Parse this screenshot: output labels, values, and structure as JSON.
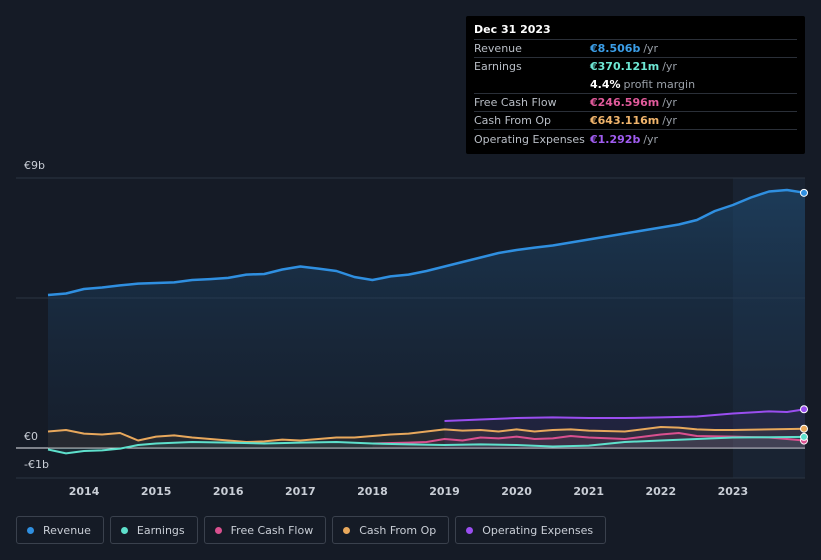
{
  "tooltip": {
    "date": "Dec 31 2023",
    "rows": [
      {
        "label": "Revenue",
        "value": "€8.506b",
        "unit": "/yr",
        "color": "#3b9ee8"
      },
      {
        "label": "Earnings",
        "value": "€370.121m",
        "unit": "/yr",
        "color": "#6ee7d4"
      },
      {
        "label": "",
        "value": "4.4%",
        "unit": "profit margin",
        "color": "#ffffff"
      },
      {
        "label": "Free Cash Flow",
        "value": "€246.596m",
        "unit": "/yr",
        "color": "#e05a9b"
      },
      {
        "label": "Cash From Op",
        "value": "€643.116m",
        "unit": "/yr",
        "color": "#f0b46c"
      },
      {
        "label": "Operating Expenses",
        "value": "€1.292b",
        "unit": "/yr",
        "color": "#a05cf0"
      }
    ]
  },
  "legend": [
    {
      "name": "Revenue",
      "color": "#2f8fe0"
    },
    {
      "name": "Earnings",
      "color": "#5ee0cc"
    },
    {
      "name": "Free Cash Flow",
      "color": "#d9508f"
    },
    {
      "name": "Cash From Op",
      "color": "#e8a85c"
    },
    {
      "name": "Operating Expenses",
      "color": "#9a4ef0"
    }
  ],
  "chart_data": {
    "type": "line",
    "yaxis_labels": [
      {
        "value": 9,
        "label": "€9b"
      },
      {
        "value": 0,
        "label": "€0"
      },
      {
        "value": -1,
        "label": "-€1b"
      }
    ],
    "ylim": [
      -1,
      9
    ],
    "xlim": [
      2013.5,
      2024.0
    ],
    "x_ticks": [
      2014,
      2015,
      2016,
      2017,
      2018,
      2019,
      2020,
      2021,
      2022,
      2023
    ],
    "highlight_from": 2023.0,
    "series": [
      {
        "name": "Revenue",
        "color": "#2f8fe0",
        "area": true,
        "points": [
          [
            2013.5,
            5.1
          ],
          [
            2013.75,
            5.15
          ],
          [
            2014.0,
            5.3
          ],
          [
            2014.25,
            5.35
          ],
          [
            2014.5,
            5.42
          ],
          [
            2014.75,
            5.48
          ],
          [
            2015.0,
            5.5
          ],
          [
            2015.25,
            5.52
          ],
          [
            2015.5,
            5.6
          ],
          [
            2015.75,
            5.63
          ],
          [
            2016.0,
            5.67
          ],
          [
            2016.25,
            5.78
          ],
          [
            2016.5,
            5.8
          ],
          [
            2016.75,
            5.95
          ],
          [
            2017.0,
            6.05
          ],
          [
            2017.25,
            5.98
          ],
          [
            2017.5,
            5.9
          ],
          [
            2017.75,
            5.7
          ],
          [
            2018.0,
            5.6
          ],
          [
            2018.25,
            5.72
          ],
          [
            2018.5,
            5.78
          ],
          [
            2018.75,
            5.9
          ],
          [
            2019.0,
            6.05
          ],
          [
            2019.25,
            6.2
          ],
          [
            2019.5,
            6.35
          ],
          [
            2019.75,
            6.5
          ],
          [
            2020.0,
            6.6
          ],
          [
            2020.25,
            6.68
          ],
          [
            2020.5,
            6.75
          ],
          [
            2020.75,
            6.85
          ],
          [
            2021.0,
            6.95
          ],
          [
            2021.25,
            7.05
          ],
          [
            2021.5,
            7.15
          ],
          [
            2021.75,
            7.25
          ],
          [
            2022.0,
            7.35
          ],
          [
            2022.25,
            7.45
          ],
          [
            2022.5,
            7.6
          ],
          [
            2022.75,
            7.9
          ],
          [
            2023.0,
            8.1
          ],
          [
            2023.25,
            8.35
          ],
          [
            2023.5,
            8.55
          ],
          [
            2023.75,
            8.6
          ],
          [
            2024.0,
            8.506
          ]
        ]
      },
      {
        "name": "Operating Expenses",
        "color": "#9a4ef0",
        "area": false,
        "points": [
          [
            2019.0,
            0.9
          ],
          [
            2019.5,
            0.95
          ],
          [
            2020.0,
            1.0
          ],
          [
            2020.5,
            1.02
          ],
          [
            2021.0,
            1.0
          ],
          [
            2021.5,
            1.0
          ],
          [
            2022.0,
            1.02
          ],
          [
            2022.5,
            1.05
          ],
          [
            2023.0,
            1.15
          ],
          [
            2023.5,
            1.22
          ],
          [
            2023.75,
            1.2
          ],
          [
            2024.0,
            1.292
          ]
        ]
      },
      {
        "name": "Cash From Op",
        "color": "#e8a85c",
        "area": false,
        "points": [
          [
            2013.5,
            0.55
          ],
          [
            2013.75,
            0.6
          ],
          [
            2014.0,
            0.48
          ],
          [
            2014.25,
            0.45
          ],
          [
            2014.5,
            0.5
          ],
          [
            2014.75,
            0.25
          ],
          [
            2015.0,
            0.38
          ],
          [
            2015.25,
            0.42
          ],
          [
            2015.5,
            0.35
          ],
          [
            2015.75,
            0.3
          ],
          [
            2016.0,
            0.25
          ],
          [
            2016.25,
            0.2
          ],
          [
            2016.5,
            0.22
          ],
          [
            2016.75,
            0.28
          ],
          [
            2017.0,
            0.25
          ],
          [
            2017.25,
            0.3
          ],
          [
            2017.5,
            0.35
          ],
          [
            2017.75,
            0.35
          ],
          [
            2018.0,
            0.4
          ],
          [
            2018.25,
            0.45
          ],
          [
            2018.5,
            0.48
          ],
          [
            2018.75,
            0.55
          ],
          [
            2019.0,
            0.62
          ],
          [
            2019.25,
            0.58
          ],
          [
            2019.5,
            0.6
          ],
          [
            2019.75,
            0.55
          ],
          [
            2020.0,
            0.62
          ],
          [
            2020.25,
            0.55
          ],
          [
            2020.5,
            0.6
          ],
          [
            2020.75,
            0.62
          ],
          [
            2021.0,
            0.58
          ],
          [
            2021.5,
            0.55
          ],
          [
            2022.0,
            0.7
          ],
          [
            2022.25,
            0.68
          ],
          [
            2022.5,
            0.62
          ],
          [
            2022.75,
            0.6
          ],
          [
            2023.0,
            0.6
          ],
          [
            2023.5,
            0.62
          ],
          [
            2024.0,
            0.643
          ]
        ]
      },
      {
        "name": "Free Cash Flow",
        "color": "#d9508f",
        "area": false,
        "points": [
          [
            2018.0,
            0.15
          ],
          [
            2018.5,
            0.18
          ],
          [
            2018.75,
            0.2
          ],
          [
            2019.0,
            0.3
          ],
          [
            2019.25,
            0.25
          ],
          [
            2019.5,
            0.35
          ],
          [
            2019.75,
            0.32
          ],
          [
            2020.0,
            0.38
          ],
          [
            2020.25,
            0.3
          ],
          [
            2020.5,
            0.32
          ],
          [
            2020.75,
            0.4
          ],
          [
            2021.0,
            0.35
          ],
          [
            2021.5,
            0.3
          ],
          [
            2022.0,
            0.45
          ],
          [
            2022.25,
            0.5
          ],
          [
            2022.5,
            0.4
          ],
          [
            2023.0,
            0.38
          ],
          [
            2023.5,
            0.35
          ],
          [
            2023.75,
            0.3
          ],
          [
            2024.0,
            0.247
          ]
        ]
      },
      {
        "name": "Earnings",
        "color": "#5ee0cc",
        "area": false,
        "points": [
          [
            2013.5,
            -0.05
          ],
          [
            2013.75,
            -0.18
          ],
          [
            2014.0,
            -0.1
          ],
          [
            2014.25,
            -0.08
          ],
          [
            2014.5,
            -0.02
          ],
          [
            2014.75,
            0.1
          ],
          [
            2015.0,
            0.15
          ],
          [
            2015.5,
            0.2
          ],
          [
            2016.0,
            0.18
          ],
          [
            2016.5,
            0.15
          ],
          [
            2017.0,
            0.18
          ],
          [
            2017.5,
            0.2
          ],
          [
            2018.0,
            0.15
          ],
          [
            2018.5,
            0.12
          ],
          [
            2019.0,
            0.1
          ],
          [
            2019.5,
            0.12
          ],
          [
            2020.0,
            0.1
          ],
          [
            2020.5,
            0.05
          ],
          [
            2021.0,
            0.08
          ],
          [
            2021.5,
            0.2
          ],
          [
            2022.0,
            0.25
          ],
          [
            2022.5,
            0.3
          ],
          [
            2023.0,
            0.35
          ],
          [
            2023.5,
            0.36
          ],
          [
            2024.0,
            0.37
          ]
        ]
      }
    ]
  }
}
